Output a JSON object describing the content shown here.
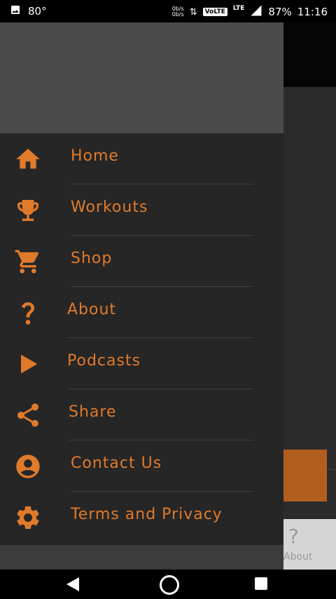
{
  "status_bar": {
    "temperature": "80°",
    "net_speed_up": "0b/s",
    "net_speed_down": "0b/s",
    "volte": "VoLTE",
    "lte": "LTE",
    "battery": "87%",
    "time": "11:16"
  },
  "menu": {
    "items": [
      {
        "label": "Home",
        "icon": "home-icon"
      },
      {
        "label": "Workouts",
        "icon": "trophy-icon"
      },
      {
        "label": "Shop",
        "icon": "cart-icon"
      },
      {
        "label": "About",
        "icon": "question-icon"
      },
      {
        "label": "Podcasts",
        "icon": "play-icon"
      },
      {
        "label": "Share",
        "icon": "share-icon"
      },
      {
        "label": "Contact Us",
        "icon": "account-circle-icon"
      },
      {
        "label": "Terms and Privacy",
        "icon": "gear-icon"
      }
    ]
  },
  "background": {
    "bottom_nav_about_icon": "?",
    "bottom_nav_about_label": "About"
  },
  "colors": {
    "accent": "#e07a2b",
    "drawer_bg": "#262626",
    "header_bg": "#4a4a4a"
  }
}
